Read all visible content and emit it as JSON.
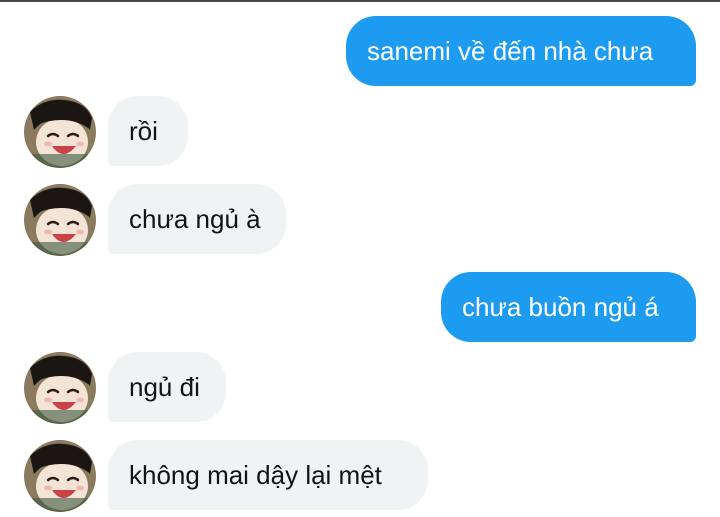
{
  "conversation": {
    "messages": [
      {
        "direction": "outgoing",
        "text": "sanemi về đến nhà chưa"
      },
      {
        "direction": "incoming",
        "text": "rồi"
      },
      {
        "direction": "incoming",
        "text": "chưa ngủ à"
      },
      {
        "direction": "outgoing",
        "text": "chưa buồn ngủ á"
      },
      {
        "direction": "incoming",
        "text": "ngủ đi"
      },
      {
        "direction": "incoming",
        "text": "không mai dậy lại mệt"
      }
    ]
  },
  "colors": {
    "outgoing_bubble": "#1d9bf0",
    "incoming_bubble": "#eff3f4",
    "outgoing_text": "#ffffff",
    "incoming_text": "#0f1419"
  },
  "icons": {
    "avatar": "contact-avatar-anime-boy"
  }
}
